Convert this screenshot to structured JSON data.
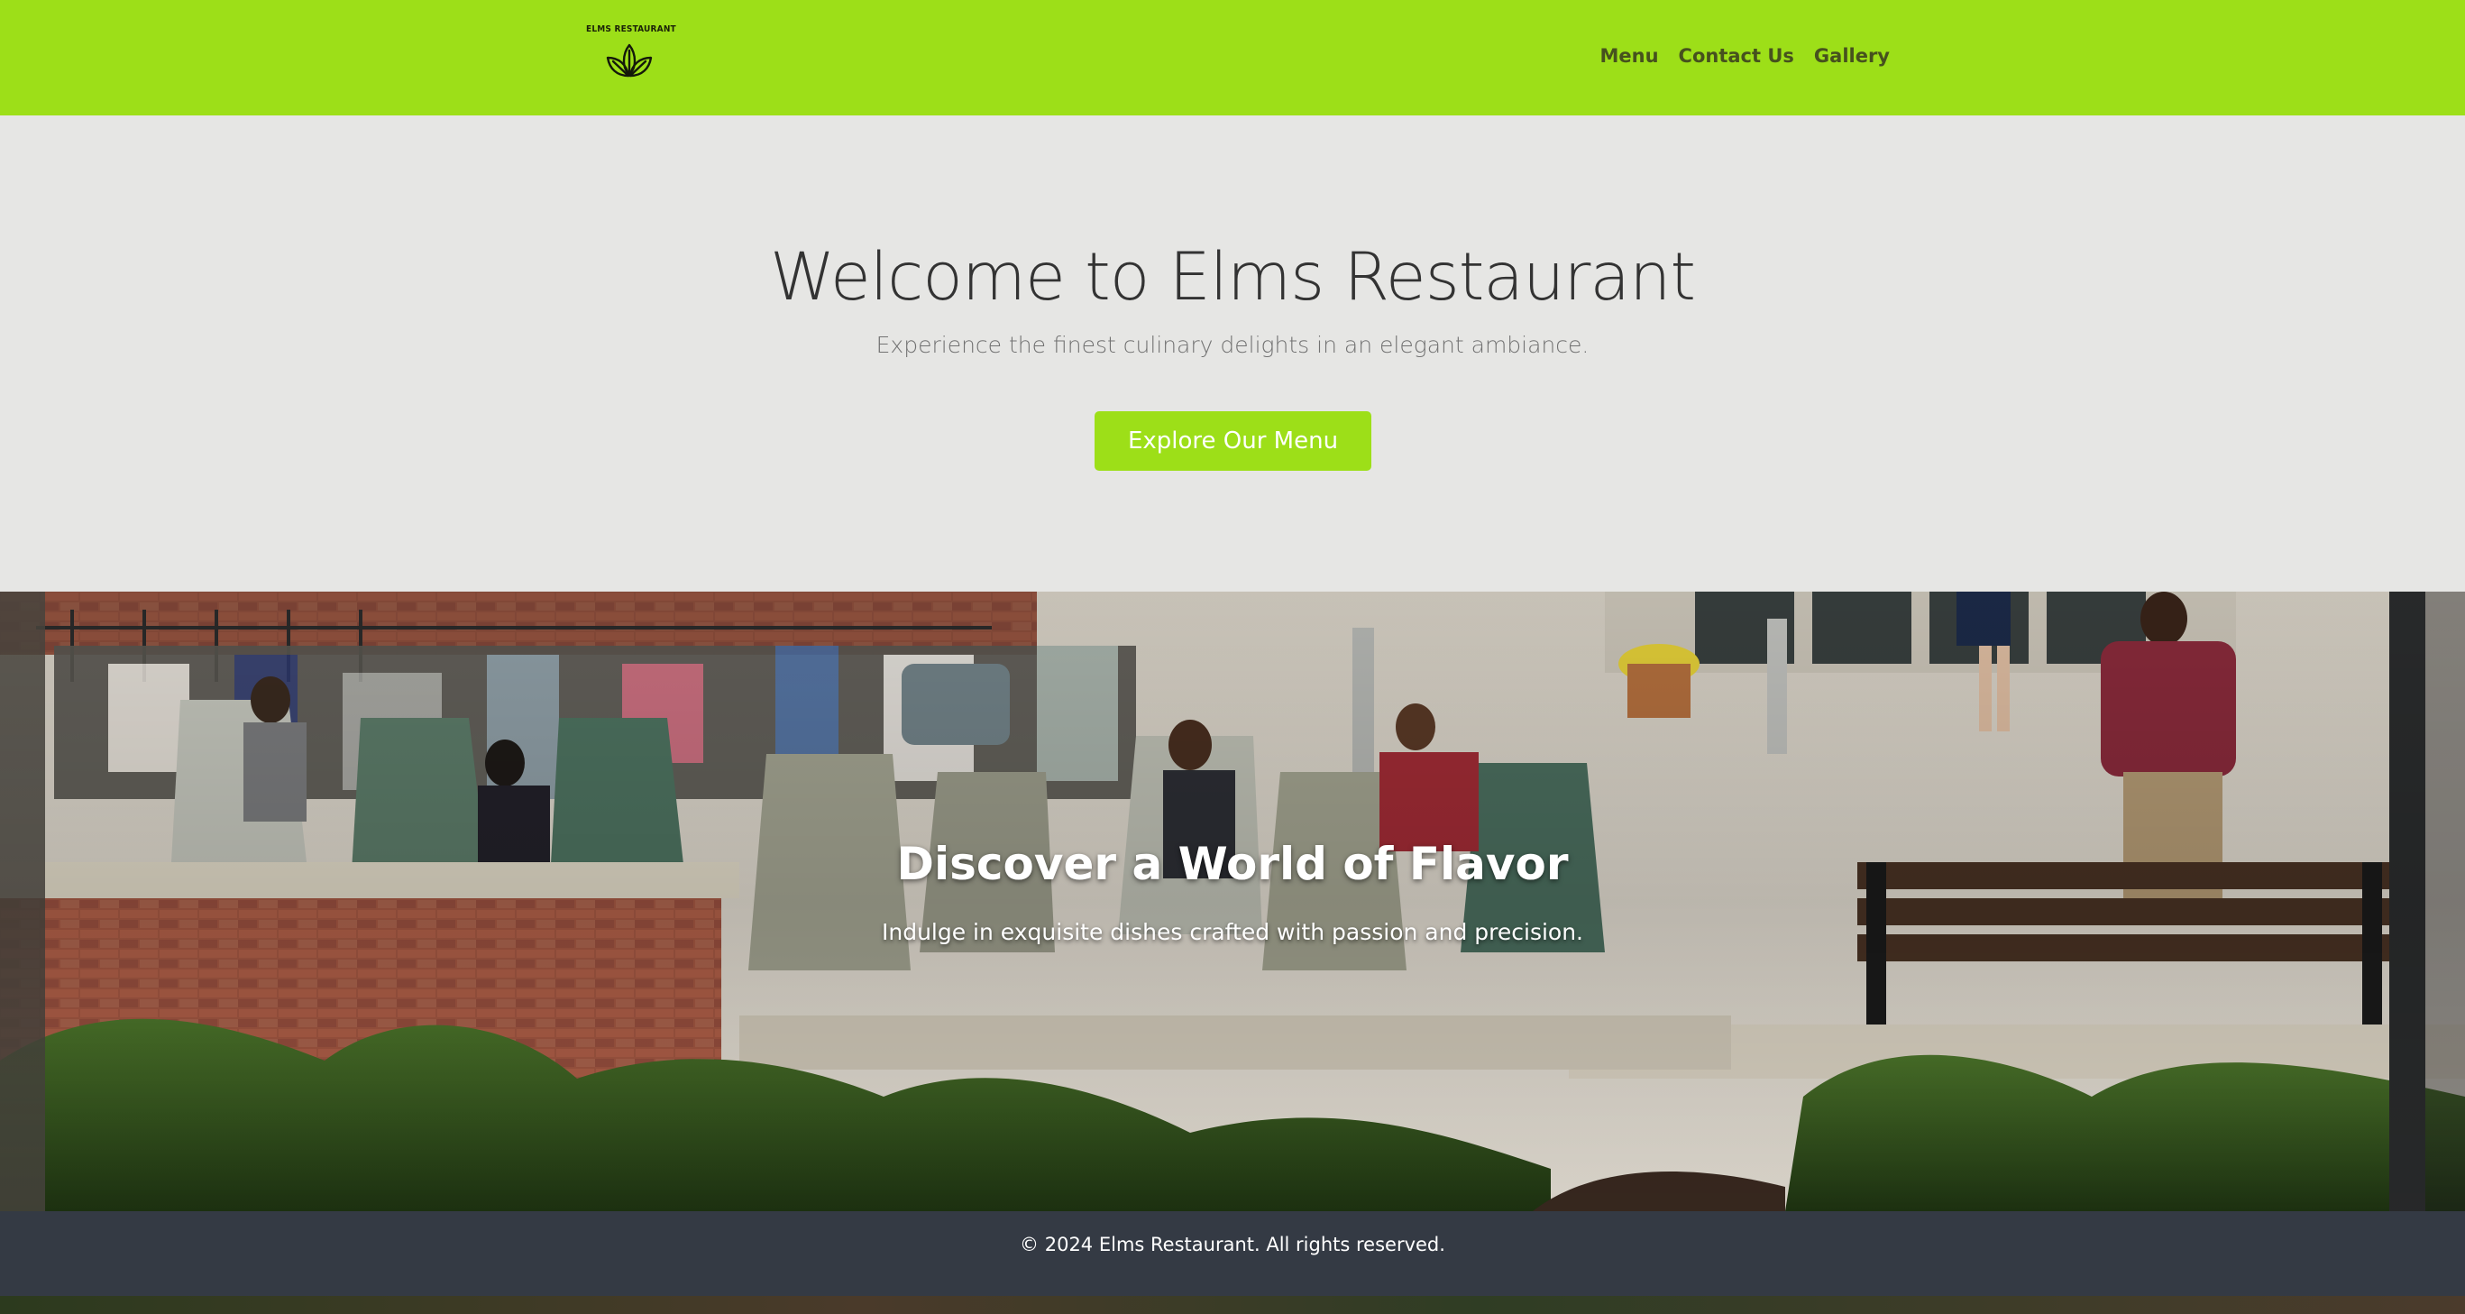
{
  "navbar": {
    "logo_text": "ELMS RESTAURANT",
    "logo_icon": "leaves-icon",
    "links": [
      "Menu",
      "Contact Us",
      "Gallery"
    ],
    "background_color": "#9ddf18"
  },
  "hero": {
    "title": "Welcome to Elms Restaurant",
    "subtitle": "Experience the finest culinary delights in an elegant ambiance.",
    "cta_label": "Explore Our Menu",
    "accent_color": "#9ddf18"
  },
  "feature": {
    "title": "Discover a World of Flavor",
    "subtitle": "Indulge in exquisite dishes crafted with passion and precision."
  },
  "footer": {
    "copyright": "© 2024 Elms Restaurant. All rights reserved.",
    "background_color": "#343a44"
  }
}
